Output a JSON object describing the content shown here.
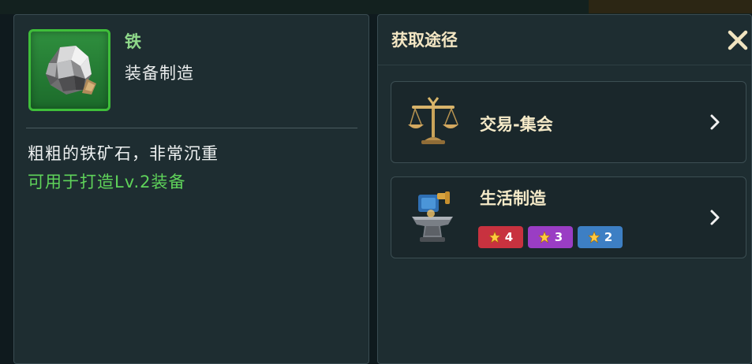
{
  "item": {
    "name": "铁",
    "category": "装备制造",
    "description": "粗粗的铁矿石，非常沉重",
    "usage": "可用于打造Lv.2装备",
    "icon": "iron-ore-icon",
    "rarity_color": "#3fbe3a"
  },
  "acquire": {
    "title": "获取途径",
    "close_icon": "close-icon",
    "sources": [
      {
        "label": "交易-集会",
        "icon": "scales-icon"
      },
      {
        "label": "生活制造",
        "icon": "anvil-icon",
        "badges": [
          {
            "value": "4",
            "color": "#c8323f"
          },
          {
            "value": "3",
            "color": "#9a3dc4"
          },
          {
            "value": "2",
            "color": "#3d7fc4"
          }
        ]
      }
    ]
  },
  "colors": {
    "panel_bg": "#1e2d31",
    "title_gold": "#f3e6c3",
    "usage_green": "#5fd35a"
  }
}
